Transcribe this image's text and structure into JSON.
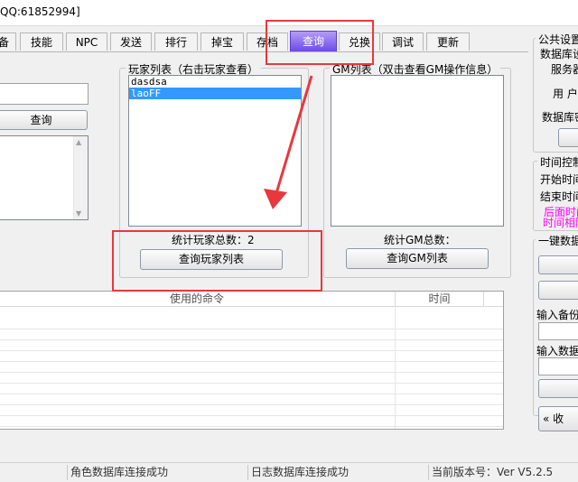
{
  "window": {
    "title": "QQ:61852994]"
  },
  "tabs": [
    {
      "label": "备",
      "active": false
    },
    {
      "label": "技能",
      "active": false
    },
    {
      "label": "NPC",
      "active": false
    },
    {
      "label": "发送",
      "active": false
    },
    {
      "label": "排行",
      "active": false
    },
    {
      "label": "掉宝",
      "active": false
    },
    {
      "label": "存档",
      "active": false
    },
    {
      "label": "查询",
      "active": true
    },
    {
      "label": "兑换",
      "active": false
    },
    {
      "label": "调试",
      "active": false
    },
    {
      "label": "更新",
      "active": false
    }
  ],
  "left_panel": {
    "query_button": "查询"
  },
  "player_list": {
    "title": "玩家列表（右击玩家查看）",
    "items": [
      {
        "name": "dasdsa",
        "selected": false
      },
      {
        "name": "laoFF",
        "selected": true
      }
    ],
    "count_label": "统计玩家总数：2",
    "query_button": "查询玩家列表"
  },
  "gm_list": {
    "title": "GM列表（双击查看GM操作信息）",
    "count_label": "统计GM总数：",
    "query_button": "查询GM列表"
  },
  "command_table": {
    "columns": [
      "使用的命令",
      "时间"
    ]
  },
  "right_panel": {
    "public_settings_title": "公共设置",
    "db_label": "数据库设",
    "server_label": "服务器",
    "user_label": "用 户",
    "db_pwd_label": "数据库密",
    "time_control_title": "时间控制",
    "start_time_label": "开始时间",
    "end_time_label": "结束时间",
    "later_time_note": "后面时间",
    "interval_note": "时间相隔",
    "one_click_title": "一键数据",
    "backup_input_label": "输入备份",
    "data_input_label": "输入数据",
    "collapse_button": "« 收"
  },
  "status_bar": {
    "role_db": "角色数据库连接成功",
    "log_db": "日志数据库连接成功",
    "version": "当前版本号：Ver V5.2.5"
  },
  "colors": {
    "active_tab_top": "#b39cf8",
    "active_tab_bottom": "#6c4ae6",
    "selection": "#3399ff",
    "annotation_red": "#e8383d",
    "note_magenta": "#ff00ff"
  }
}
